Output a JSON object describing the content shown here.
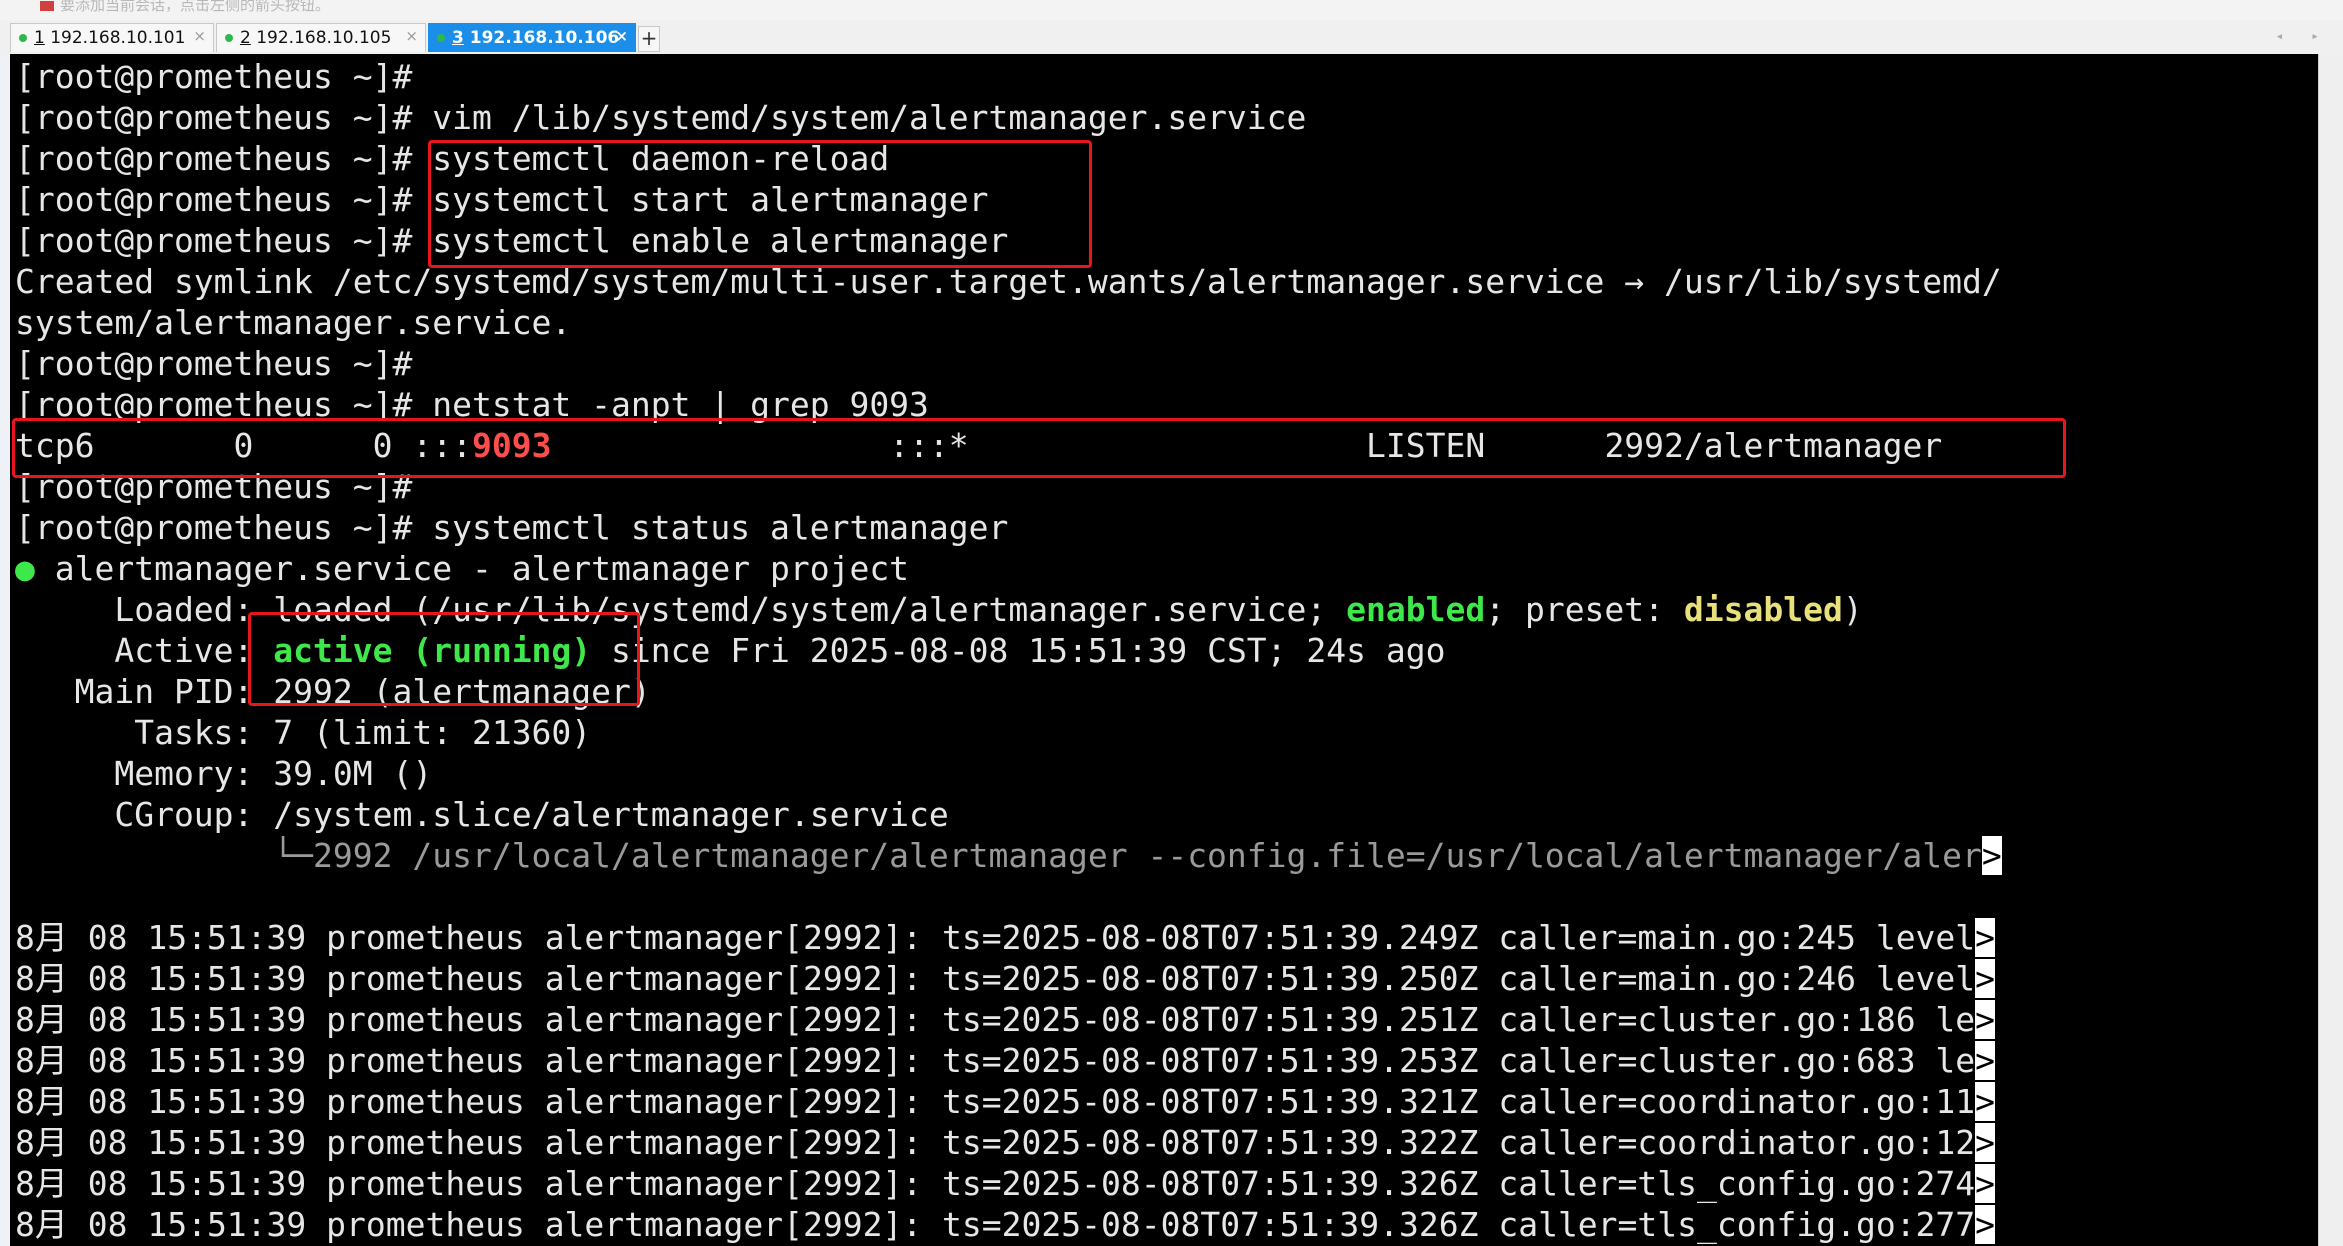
{
  "hint_text": "要添加当前会话，点击左侧的箭头按钮。",
  "tabs": [
    {
      "num": "1",
      "label": "192.168.10.101",
      "close": "×"
    },
    {
      "num": "2",
      "label": "192.168.10.105",
      "close": "×"
    },
    {
      "num": "3",
      "label": "192.168.10.106",
      "close": "×"
    }
  ],
  "active_tab_index": 2,
  "add_tab": "+",
  "nav_arrows": "◂ ▸",
  "colors": {
    "terminal_bg": "#000000",
    "text": "#e6e6e6",
    "highlight_port": "#ff4d4d",
    "status_green": "#3fe84a",
    "status_yellow": "#e8e07a",
    "annotation_red": "#e8151b",
    "active_tab": "#1a8ee8"
  },
  "terminal": {
    "prompt": "[root@prometheus ~]#",
    "cmd_vim": " vim /lib/systemd/system/alertmanager.service",
    "cmd_reload": "systemctl daemon-reload",
    "cmd_start": "systemctl start alertmanager",
    "cmd_enable": "systemctl enable alertmanager",
    "symlink_1": "Created symlink /etc/systemd/system/multi-user.target.wants/alertmanager.service → /usr/lib/systemd/",
    "symlink_2": "system/alertmanager.service.",
    "cmd_netstat": " netstat -anpt | grep 9093",
    "netstat_pre": "tcp6       0      0 :::",
    "netstat_port": "9093",
    "netstat_post": "                 :::*                    LISTEN      2992/alertmanager",
    "cmd_status": " systemctl status alertmanager",
    "status_dot": "●",
    "unit_title": " alertmanager.service - alertmanager project",
    "loaded_pre": "     Loaded: loaded (/usr/lib/systemd/system/alertmanager.service; ",
    "loaded_enabled": "enabled",
    "loaded_mid": "; preset: ",
    "loaded_disabled": "disabled",
    "loaded_end": ")",
    "active_pre": "     Active: ",
    "active_state": "active (running)",
    "active_post": " since Fri 2025-08-08 15:51:39 CST; 24s ago",
    "main_pid": "   Main PID: 2992 (alertmanager)",
    "tasks": "      Tasks: 7 (limit: 21360)",
    "memory": "     Memory: 39.0M ()",
    "cgroup": "     CGroup: /system.slice/alertmanager.service",
    "cgroup_tree": "             └─2992 /usr/local/alertmanager/alertmanager --config.file=/usr/local/alertmanager/aler",
    "trunc": ">",
    "logs": [
      "8月 08 15:51:39 prometheus alertmanager[2992]: ts=2025-08-08T07:51:39.249Z caller=main.go:245 level",
      "8月 08 15:51:39 prometheus alertmanager[2992]: ts=2025-08-08T07:51:39.250Z caller=main.go:246 level",
      "8月 08 15:51:39 prometheus alertmanager[2992]: ts=2025-08-08T07:51:39.251Z caller=cluster.go:186 le",
      "8月 08 15:51:39 prometheus alertmanager[2992]: ts=2025-08-08T07:51:39.253Z caller=cluster.go:683 le",
      "8月 08 15:51:39 prometheus alertmanager[2992]: ts=2025-08-08T07:51:39.321Z caller=coordinator.go:11",
      "8月 08 15:51:39 prometheus alertmanager[2992]: ts=2025-08-08T07:51:39.322Z caller=coordinator.go:12",
      "8月 08 15:51:39 prometheus alertmanager[2992]: ts=2025-08-08T07:51:39.326Z caller=tls_config.go:274",
      "8月 08 15:51:39 prometheus alertmanager[2992]: ts=2025-08-08T07:51:39.326Z caller=tls_config.go:277"
    ]
  }
}
